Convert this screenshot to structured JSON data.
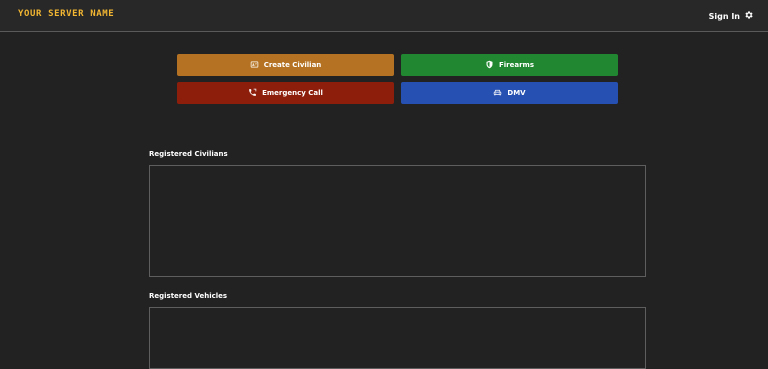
{
  "header": {
    "brand": "YOUR SERVER NAME",
    "signin_label": "Sign In",
    "signin_icon": "gear-icon"
  },
  "actions": {
    "create_civilian": {
      "label": "Create Civilian",
      "icon": "id-card-icon",
      "color": "#b47222"
    },
    "firearms": {
      "label": "Firearms",
      "icon": "shield-icon",
      "color": "#218831"
    },
    "emergency_call": {
      "label": "Emergency Call",
      "icon": "phone-icon",
      "color": "#8d1e0c"
    },
    "dmv": {
      "label": "DMV",
      "icon": "car-icon",
      "color": "#2650b1"
    }
  },
  "sections": {
    "civilians_title": "Registered Civilians",
    "vehicles_title": "Registered Vehicles"
  },
  "colors": {
    "background": "#222222",
    "brand": "#f2b632"
  }
}
